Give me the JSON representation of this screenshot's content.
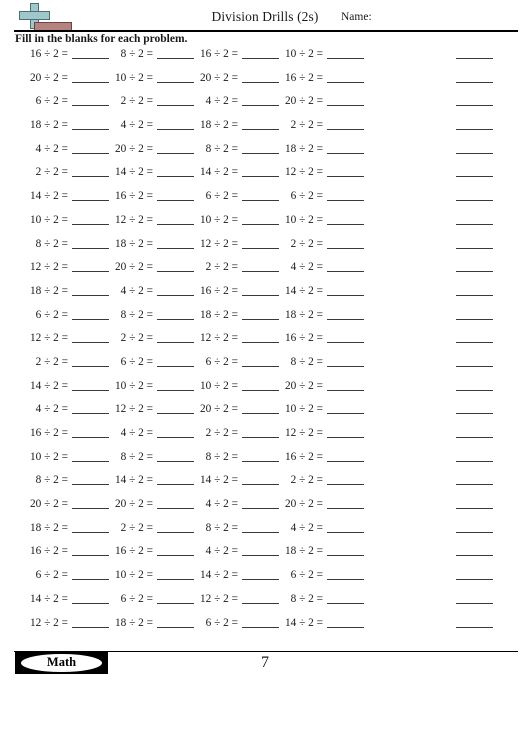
{
  "header": {
    "title": "Division Drills (2s)",
    "name_label": "Name:",
    "instruction": "Fill in the blanks for each problem.",
    "logo_icon": "plus-minus-icon"
  },
  "worksheet": {
    "operator": "÷",
    "divisor": "2",
    "equals": "=",
    "columns": 5,
    "rows": 25,
    "trailing_blank_column": true,
    "problems": [
      [
        "16 ÷ 2 =",
        "8 ÷ 2 =",
        "16 ÷ 2 =",
        "10 ÷ 2 =",
        ""
      ],
      [
        "20 ÷ 2 =",
        "10 ÷ 2 =",
        "20 ÷ 2 =",
        "16 ÷ 2 =",
        ""
      ],
      [
        "6 ÷ 2 =",
        "2 ÷ 2 =",
        "4 ÷ 2 =",
        "20 ÷ 2 =",
        ""
      ],
      [
        "18 ÷ 2 =",
        "4 ÷ 2 =",
        "18 ÷ 2 =",
        "2 ÷ 2 =",
        ""
      ],
      [
        "4 ÷ 2 =",
        "20 ÷ 2 =",
        "8 ÷ 2 =",
        "18 ÷ 2 =",
        ""
      ],
      [
        "2 ÷ 2 =",
        "14 ÷ 2 =",
        "14 ÷ 2 =",
        "12 ÷ 2 =",
        ""
      ],
      [
        "14 ÷ 2 =",
        "16 ÷ 2 =",
        "6 ÷ 2 =",
        "6 ÷ 2 =",
        ""
      ],
      [
        "10 ÷ 2 =",
        "12 ÷ 2 =",
        "10 ÷ 2 =",
        "10 ÷ 2 =",
        ""
      ],
      [
        "8 ÷ 2 =",
        "18 ÷ 2 =",
        "12 ÷ 2 =",
        "2 ÷ 2 =",
        ""
      ],
      [
        "12 ÷ 2 =",
        "20 ÷ 2 =",
        "2 ÷ 2 =",
        "4 ÷ 2 =",
        ""
      ],
      [
        "18 ÷ 2 =",
        "4 ÷ 2 =",
        "16 ÷ 2 =",
        "14 ÷ 2 =",
        ""
      ],
      [
        "6 ÷ 2 =",
        "8 ÷ 2 =",
        "18 ÷ 2 =",
        "18 ÷ 2 =",
        ""
      ],
      [
        "12 ÷ 2 =",
        "2 ÷ 2 =",
        "12 ÷ 2 =",
        "16 ÷ 2 =",
        ""
      ],
      [
        "2 ÷ 2 =",
        "6 ÷ 2 =",
        "6 ÷ 2 =",
        "8 ÷ 2 =",
        ""
      ],
      [
        "14 ÷ 2 =",
        "10 ÷ 2 =",
        "10 ÷ 2 =",
        "20 ÷ 2 =",
        ""
      ],
      [
        "4 ÷ 2 =",
        "12 ÷ 2 =",
        "20 ÷ 2 =",
        "10 ÷ 2 =",
        ""
      ],
      [
        "16 ÷ 2 =",
        "4 ÷ 2 =",
        "2 ÷ 2 =",
        "12 ÷ 2 =",
        ""
      ],
      [
        "10 ÷ 2 =",
        "8 ÷ 2 =",
        "8 ÷ 2 =",
        "16 ÷ 2 =",
        ""
      ],
      [
        "8 ÷ 2 =",
        "14 ÷ 2 =",
        "14 ÷ 2 =",
        "2 ÷ 2 =",
        ""
      ],
      [
        "20 ÷ 2 =",
        "20 ÷ 2 =",
        "4 ÷ 2 =",
        "20 ÷ 2 =",
        ""
      ],
      [
        "18 ÷ 2 =",
        "2 ÷ 2 =",
        "8 ÷ 2 =",
        "4 ÷ 2 =",
        ""
      ],
      [
        "16 ÷ 2 =",
        "16 ÷ 2 =",
        "4 ÷ 2 =",
        "18 ÷ 2 =",
        ""
      ],
      [
        "6 ÷ 2 =",
        "10 ÷ 2 =",
        "14 ÷ 2 =",
        "6 ÷ 2 =",
        ""
      ],
      [
        "14 ÷ 2 =",
        "6 ÷ 2 =",
        "12 ÷ 2 =",
        "8 ÷ 2 =",
        ""
      ],
      [
        "12 ÷ 2 =",
        "18 ÷ 2 =",
        "6 ÷ 2 =",
        "14 ÷ 2 =",
        ""
      ]
    ]
  },
  "footer": {
    "badge_label": "Math",
    "page_number": "7"
  },
  "colors": {
    "text": "#1a1a1a",
    "rule": "#000000",
    "blank_line": "#3a3a3a",
    "logo_plus": "#9fc7cc",
    "logo_plus_stroke": "#4e6e72",
    "logo_minus": "#b4827f",
    "logo_minus_stroke": "#6b4442",
    "badge_bg": "#000000",
    "badge_ellipse": "#ffffff"
  }
}
